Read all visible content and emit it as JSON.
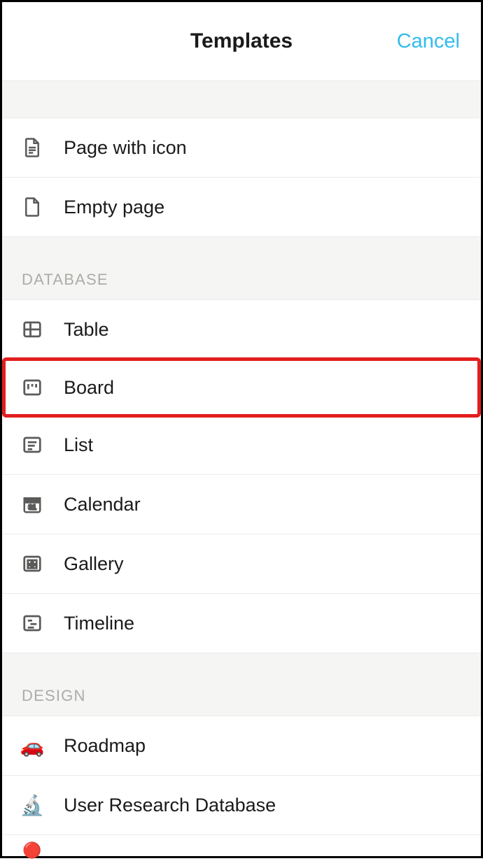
{
  "header": {
    "title": "Templates",
    "cancel": "Cancel"
  },
  "sections": {
    "basic": [
      {
        "icon": "page-with-icon",
        "label": "Page with icon"
      },
      {
        "icon": "empty-page",
        "label": "Empty page"
      }
    ],
    "database": {
      "title": "DATABASE",
      "items": [
        {
          "icon": "table",
          "label": "Table"
        },
        {
          "icon": "board",
          "label": "Board",
          "highlighted": true
        },
        {
          "icon": "list",
          "label": "List"
        },
        {
          "icon": "calendar",
          "label": "Calendar"
        },
        {
          "icon": "gallery",
          "label": "Gallery"
        },
        {
          "icon": "timeline",
          "label": "Timeline"
        }
      ]
    },
    "design": {
      "title": "DESIGN",
      "items": [
        {
          "emoji": "🚗",
          "label": "Roadmap"
        },
        {
          "emoji": "🔬",
          "label": "User Research Database"
        }
      ]
    }
  }
}
